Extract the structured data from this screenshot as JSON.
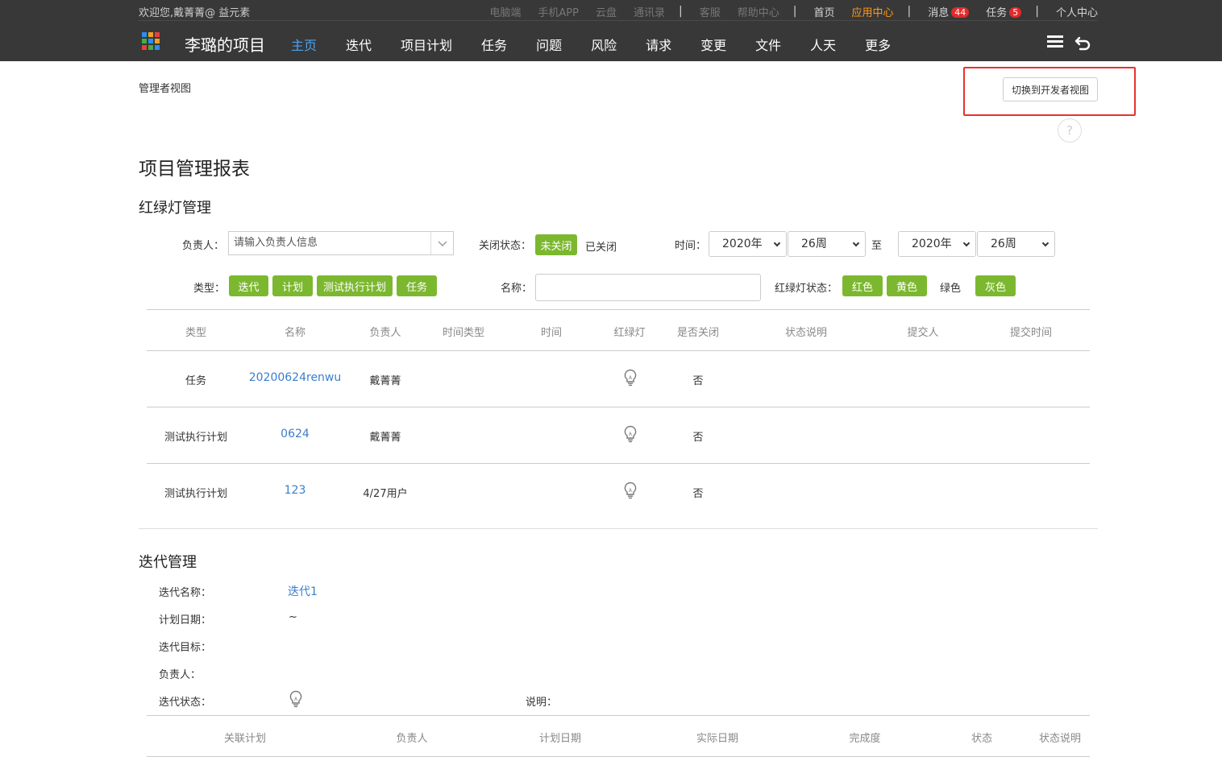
{
  "header": {
    "welcome": "欢迎您,戴菁菁@ 益元素",
    "links": [
      {
        "label": "电脑端"
      },
      {
        "label": "手机APP"
      },
      {
        "label": "云盘"
      },
      {
        "label": "通讯录"
      },
      {
        "label": "客服"
      },
      {
        "label": "帮助中心"
      },
      {
        "label": "首页"
      },
      {
        "label": "应用中心"
      },
      {
        "label": "消息"
      },
      {
        "label": "任务"
      },
      {
        "label": "个人中心"
      }
    ],
    "separator": "|",
    "msg_badge": "44",
    "task_badge": "5",
    "project_title": "李璐的项目",
    "nav": [
      "主页",
      "迭代",
      "项目计划",
      "任务",
      "问题",
      "风险",
      "请求",
      "变更",
      "文件",
      "人天",
      "更多"
    ],
    "active_nav": "主页",
    "app_icon_colors": [
      "#2d8ef0",
      "#f0a020",
      "#e84040",
      "#40b040",
      "#2d8ef0",
      "#f0a020",
      "#e84040",
      "#40b040",
      "#2d8ef0"
    ]
  },
  "subheader": {
    "view_label": "管理者视图",
    "switch_button": "切换到开发者视图",
    "help": "?"
  },
  "report": {
    "title": "项目管理报表",
    "light_section": "红绿灯管理",
    "filters": {
      "owner_label": "负责人：",
      "owner_placeholder": "请输入负责人信息",
      "close_label": "关闭状态：",
      "close_open": "未关闭",
      "close_closed": "已关闭",
      "time_label": "时间：",
      "year_from": "2020年",
      "week_from": "26周",
      "to": "至",
      "year_to": "2020年",
      "week_to": "26周",
      "type_label": "类型：",
      "types": [
        "迭代",
        "计划",
        "测试执行计划",
        "任务"
      ],
      "name_label": "名称：",
      "name_value": "",
      "light_label": "红绿灯状态：",
      "light_red": "红色",
      "light_yellow": "黄色",
      "light_green": "绿色",
      "light_gray": "灰色"
    },
    "columns": [
      "类型",
      "名称",
      "负责人",
      "时间类型",
      "时间",
      "红绿灯",
      "是否关闭",
      "状态说明",
      "提交人",
      "提交时间"
    ],
    "rows": [
      {
        "type": "任务",
        "name": "20200624renwu",
        "owner": "戴菁菁",
        "closed": "否"
      },
      {
        "type": "测试执行计划",
        "name": "0624",
        "owner": "戴菁菁",
        "closed": "否"
      },
      {
        "type": "测试执行计划",
        "name": "123",
        "owner": "4/27用户",
        "closed": "否"
      }
    ],
    "tag_color": "#7cb82f",
    "link_color": "#3a7fcc"
  },
  "iteration": {
    "section": "迭代管理",
    "name_label": "迭代名称：",
    "name_value": "迭代1",
    "date_label": "计划日期：",
    "date_value": "~",
    "goal_label": "迭代目标：",
    "owner_label": "负责人：",
    "status_label": "迭代状态：",
    "desc_label": "说明：",
    "columns": [
      "关联计划",
      "负责人",
      "计划日期",
      "实际日期",
      "完成度",
      "状态",
      "状态说明"
    ]
  }
}
